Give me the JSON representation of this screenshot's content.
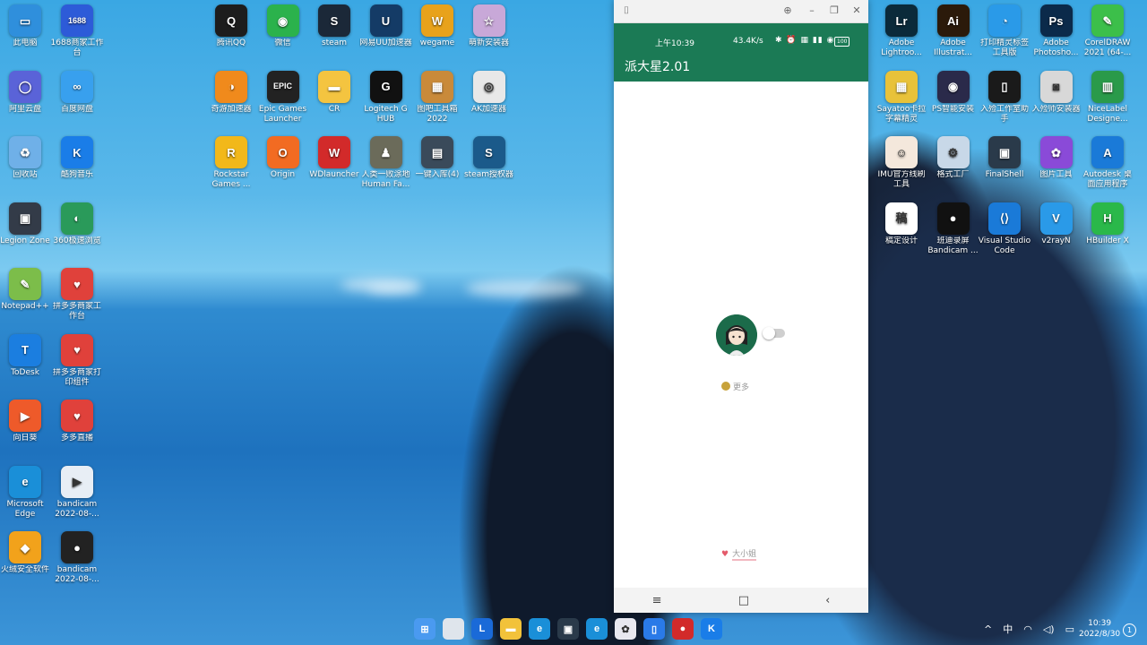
{
  "desktop_left_col1": [
    {
      "label": "此电脑",
      "color": "#2f8fdc",
      "glyph": "▭"
    },
    {
      "label": "阿里云盘",
      "color": "#5a63d8",
      "glyph": "◯"
    },
    {
      "label": "回收站",
      "color": "#6fb0e8",
      "glyph": "♻"
    },
    {
      "label": "Legion Zone",
      "color": "#333b48",
      "glyph": "▣"
    },
    {
      "label": "Notepad++",
      "color": "#7cbd4a",
      "glyph": "✎"
    },
    {
      "label": "ToDesk",
      "color": "#1b7ee0",
      "glyph": "T"
    },
    {
      "label": "向日葵",
      "color": "#ee5a2a",
      "glyph": "▶"
    },
    {
      "label": "Microsoft Edge",
      "color": "#1a8fd8",
      "glyph": "e"
    },
    {
      "label": "火绒安全软件",
      "color": "#f2a21b",
      "glyph": "◆"
    }
  ],
  "desktop_left_col2": [
    {
      "label": "1688商家工作台",
      "color": "#2d5bd8",
      "glyph": "1688"
    },
    {
      "label": "百度网盘",
      "color": "#38a0ee",
      "glyph": "∞"
    },
    {
      "label": "酷狗音乐",
      "color": "#1a7de8",
      "glyph": "K"
    },
    {
      "label": "360极速浏览",
      "color": "#2a9a5a",
      "glyph": "◐"
    },
    {
      "label": "拼多多商家工作台",
      "color": "#e0413b",
      "glyph": "♥"
    },
    {
      "label": "拼多多商家打印组件",
      "color": "#e0413b",
      "glyph": "♥"
    },
    {
      "label": "多多直播",
      "color": "#e0413b",
      "glyph": "♥"
    },
    {
      "label": "bandicam 2022-08-...",
      "color": "#e8eef5",
      "glyph": "▶"
    },
    {
      "label": "bandicam 2022-08-...",
      "color": "#222222",
      "glyph": "●"
    }
  ],
  "desktop_mid_rows": [
    [
      {
        "label": "腾讯QQ",
        "color": "#1d1d1d",
        "glyph": "Q"
      },
      {
        "label": "微信",
        "color": "#2bb24c",
        "glyph": "◉"
      },
      {
        "label": "steam",
        "color": "#1b2838",
        "glyph": "S"
      },
      {
        "label": "网易UU加速器",
        "color": "#143b66",
        "glyph": "U"
      },
      {
        "label": "wegame",
        "color": "#e8a21b",
        "glyph": "W"
      },
      {
        "label": "萌新安装器",
        "color": "#c8a8d8",
        "glyph": "☆"
      }
    ],
    [
      {
        "label": "奇游加速器",
        "color": "#f08a1c",
        "glyph": "◑"
      },
      {
        "label": "Epic Games Launcher",
        "color": "#222222",
        "glyph": "EPIC"
      },
      {
        "label": "CR",
        "color": "#f4c440",
        "glyph": "▬"
      },
      {
        "label": "Logitech G HUB",
        "color": "#111111",
        "glyph": "G"
      },
      {
        "label": "图吧工具箱2022",
        "color": "#c98a3a",
        "glyph": "▦"
      },
      {
        "label": "AK加速器",
        "color": "#e8e8e8",
        "glyph": "◎"
      }
    ],
    [
      {
        "label": "Rockstar Games ...",
        "color": "#f2b81a",
        "glyph": "R"
      },
      {
        "label": "Origin",
        "color": "#f26b22",
        "glyph": "O"
      },
      {
        "label": "WDlauncher",
        "color": "#d22a2a",
        "glyph": "W"
      },
      {
        "label": "人类一败涂地 Human Fa...",
        "color": "#6b6b5a",
        "glyph": "♟"
      },
      {
        "label": "一键入库(4)",
        "color": "#3a4a5a",
        "glyph": "▤"
      },
      {
        "label": "steam授权器",
        "color": "#1b5a8a",
        "glyph": "S"
      }
    ]
  ],
  "desktop_right_rows": [
    [
      {
        "label": "Adobe Lightroo...",
        "color": "#0b2a3a",
        "glyph": "Lr"
      },
      {
        "label": "Adobe Illustrat...",
        "color": "#2b1a0a",
        "glyph": "Ai"
      },
      {
        "label": "打印精灵标签工具版",
        "color": "#2a9ae8",
        "glyph": "◔"
      },
      {
        "label": "Adobe Photosho...",
        "color": "#0b2a4a",
        "glyph": "Ps"
      },
      {
        "label": "CorelDRAW 2021 (64-...",
        "color": "#3cbf4a",
        "glyph": "✎"
      }
    ],
    [
      {
        "label": "Sayatoo卡拉字幕精灵",
        "color": "#e8c23a",
        "glyph": "▦"
      },
      {
        "label": "PS智能安装",
        "color": "#2a2a4a",
        "glyph": "◉"
      },
      {
        "label": "入殓工作室助手",
        "color": "#1a1a1a",
        "glyph": "▯"
      },
      {
        "label": "入殓师安装器",
        "color": "#d8d8d8",
        "glyph": "◙"
      },
      {
        "label": "NiceLabel Designe...",
        "color": "#2a9a4a",
        "glyph": "▥"
      }
    ],
    [
      {
        "label": "IMU官方线刷工具",
        "color": "#f4e8dc",
        "glyph": "☺"
      },
      {
        "label": "格式工厂",
        "color": "#c8d8e8",
        "glyph": "⚙"
      },
      {
        "label": "FinalShell",
        "color": "#2a3a4a",
        "glyph": "▣"
      },
      {
        "label": "图片工具",
        "color": "#8a4ad8",
        "glyph": "✿"
      },
      {
        "label": "Autodesk 桌面应用程序",
        "color": "#1a7ad8",
        "glyph": "A"
      }
    ],
    [
      {
        "label": "稿定设计",
        "color": "#ffffff",
        "glyph": "稿"
      },
      {
        "label": "班迪录屏 Bandicam ...",
        "color": "#111111",
        "glyph": "●"
      },
      {
        "label": "Visual Studio Code",
        "color": "#1a7ad8",
        "glyph": "⟨⟩"
      },
      {
        "label": "v2rayN",
        "color": "#2a9ae8",
        "glyph": "V"
      },
      {
        "label": "HBuilder X",
        "color": "#2ab84a",
        "glyph": "H"
      }
    ]
  ],
  "phone": {
    "status_time": "上午10:39",
    "status_speed": "43.4K/s",
    "status_icons": "✱ ⏰ ▦ ▮▮ ◉",
    "battery": "100",
    "app_title": "派大星2.01",
    "more_label": "更多",
    "footer_label": "大小姐",
    "nav_menu": "≡",
    "nav_home": "□",
    "nav_back": "‹"
  },
  "taskbar": {
    "apps": [
      {
        "name": "start",
        "color": "#4a9af0",
        "glyph": "⊞"
      },
      {
        "name": "explorer-blank",
        "color": "#dfe5ec",
        "glyph": ""
      },
      {
        "name": "l-app",
        "color": "#1a6ad8",
        "glyph": "L"
      },
      {
        "name": "file-explorer",
        "color": "#f2c23a",
        "glyph": "▬"
      },
      {
        "name": "edge",
        "color": "#1a8fd8",
        "glyph": "e"
      },
      {
        "name": "legion",
        "color": "#2a3a4a",
        "glyph": "▣"
      },
      {
        "name": "edge-2",
        "color": "#1a8fd8",
        "glyph": "e"
      },
      {
        "name": "colorful-app",
        "color": "#e8e8f0",
        "glyph": "✿"
      },
      {
        "name": "phone-mirror",
        "color": "#2a7ae8",
        "glyph": "▯"
      },
      {
        "name": "bandicam",
        "color": "#d22a2a",
        "glyph": "●"
      },
      {
        "name": "kugou",
        "color": "#1a7de8",
        "glyph": "K"
      }
    ],
    "tray": {
      "chevron": "^",
      "ime": "中"
    },
    "time": "10:39",
    "date": "2022/8/30",
    "notifications": "1"
  }
}
